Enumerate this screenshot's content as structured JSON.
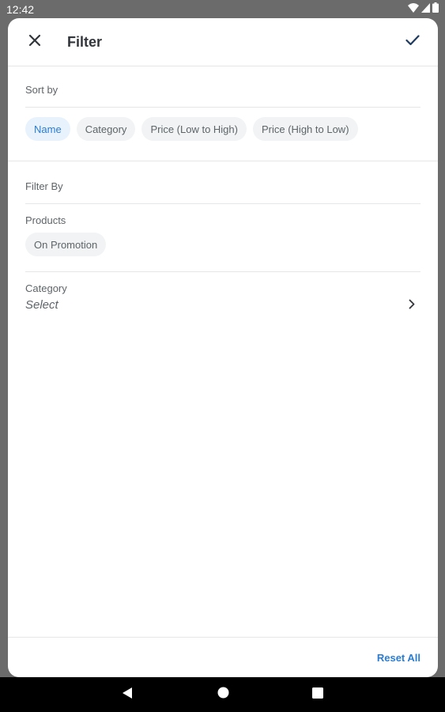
{
  "status_bar": {
    "time": "12:42",
    "icons": [
      "wifi-icon",
      "signal-icon",
      "battery-icon"
    ]
  },
  "header": {
    "title": "Filter",
    "close_icon": "close-icon",
    "confirm_icon": "check-icon"
  },
  "sort": {
    "label": "Sort by",
    "options": [
      {
        "label": "Name",
        "selected": true
      },
      {
        "label": "Category",
        "selected": false
      },
      {
        "label": "Price (Low to High)",
        "selected": false
      },
      {
        "label": "Price (High to Low)",
        "selected": false
      }
    ]
  },
  "filter": {
    "label": "Filter By",
    "products_label": "Products",
    "products_options": [
      {
        "label": "On Promotion",
        "selected": false
      }
    ],
    "category_label": "Category",
    "category_value": "Select"
  },
  "footer": {
    "reset_label": "Reset All"
  },
  "nav_bar": {
    "icons": [
      "back-icon",
      "home-icon",
      "recents-icon"
    ]
  },
  "colors": {
    "accent": "#2b7cd3",
    "selected_chip_bg": "#e8f2fd",
    "chip_bg": "#f1f3f4",
    "text_primary": "#32363a",
    "text_secondary": "#5e6468",
    "divider": "#e4e6e8",
    "scrim": "#6b6b6b"
  }
}
